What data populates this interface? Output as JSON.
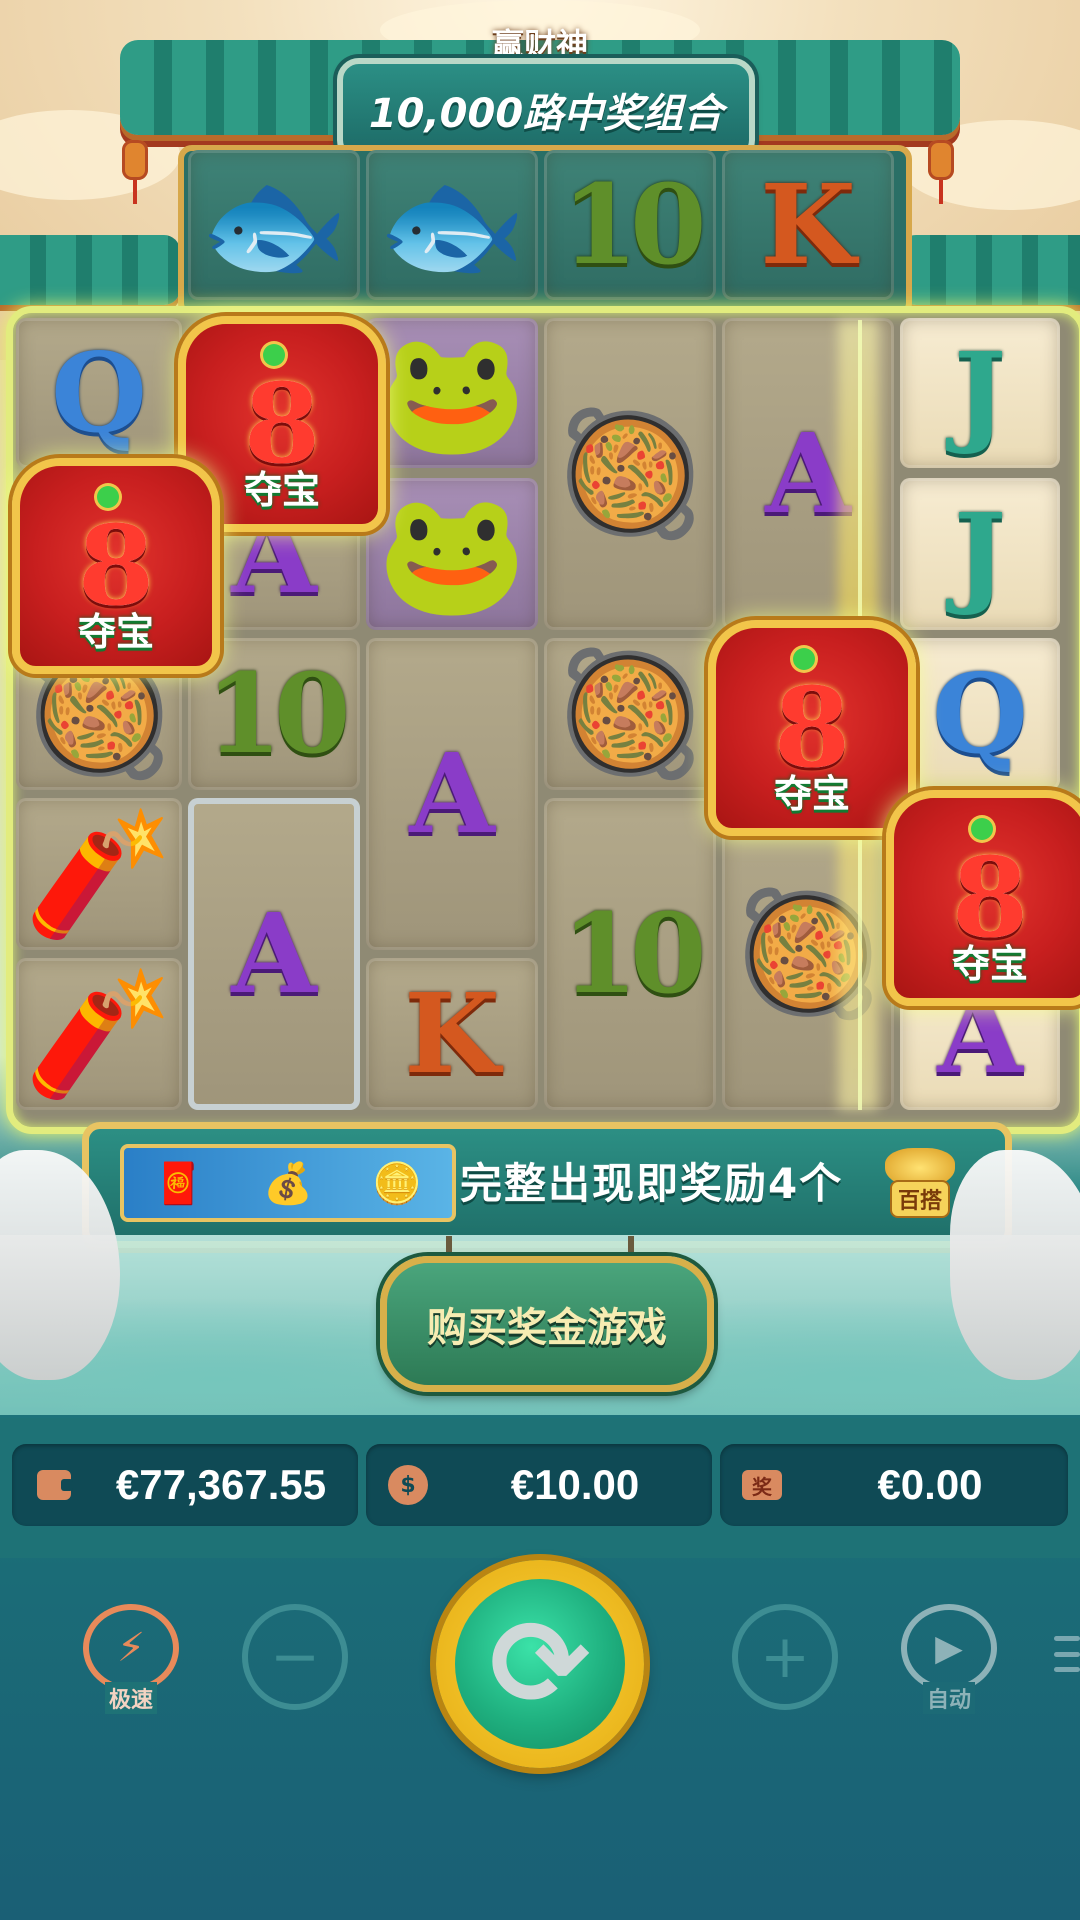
{
  "game": {
    "title": "赢财神",
    "ways_banner": "10,000路中奖组合"
  },
  "reels": {
    "top_row": [
      "fish",
      "fish",
      "10",
      "K"
    ],
    "scatter_label": "夺宝",
    "scatter_number": "8"
  },
  "promo": {
    "text": "完整出现即奖励4个",
    "ingot_label": "百搭"
  },
  "buy_feature": {
    "label": "购买奖金游戏"
  },
  "stats": {
    "balance": "€77,367.55",
    "bet": "€10.00",
    "win": "€0.00",
    "prize_icon_text": "奖"
  },
  "controls": {
    "turbo_label": "极速",
    "auto_label": "自动",
    "minus_glyph": "−",
    "plus_glyph": "+",
    "spin_glyph": "⟳"
  },
  "colors": {
    "frame_glow": "#e2ec7e",
    "spin_gold": "#f9d23a",
    "spin_green": "#1fb07f"
  }
}
